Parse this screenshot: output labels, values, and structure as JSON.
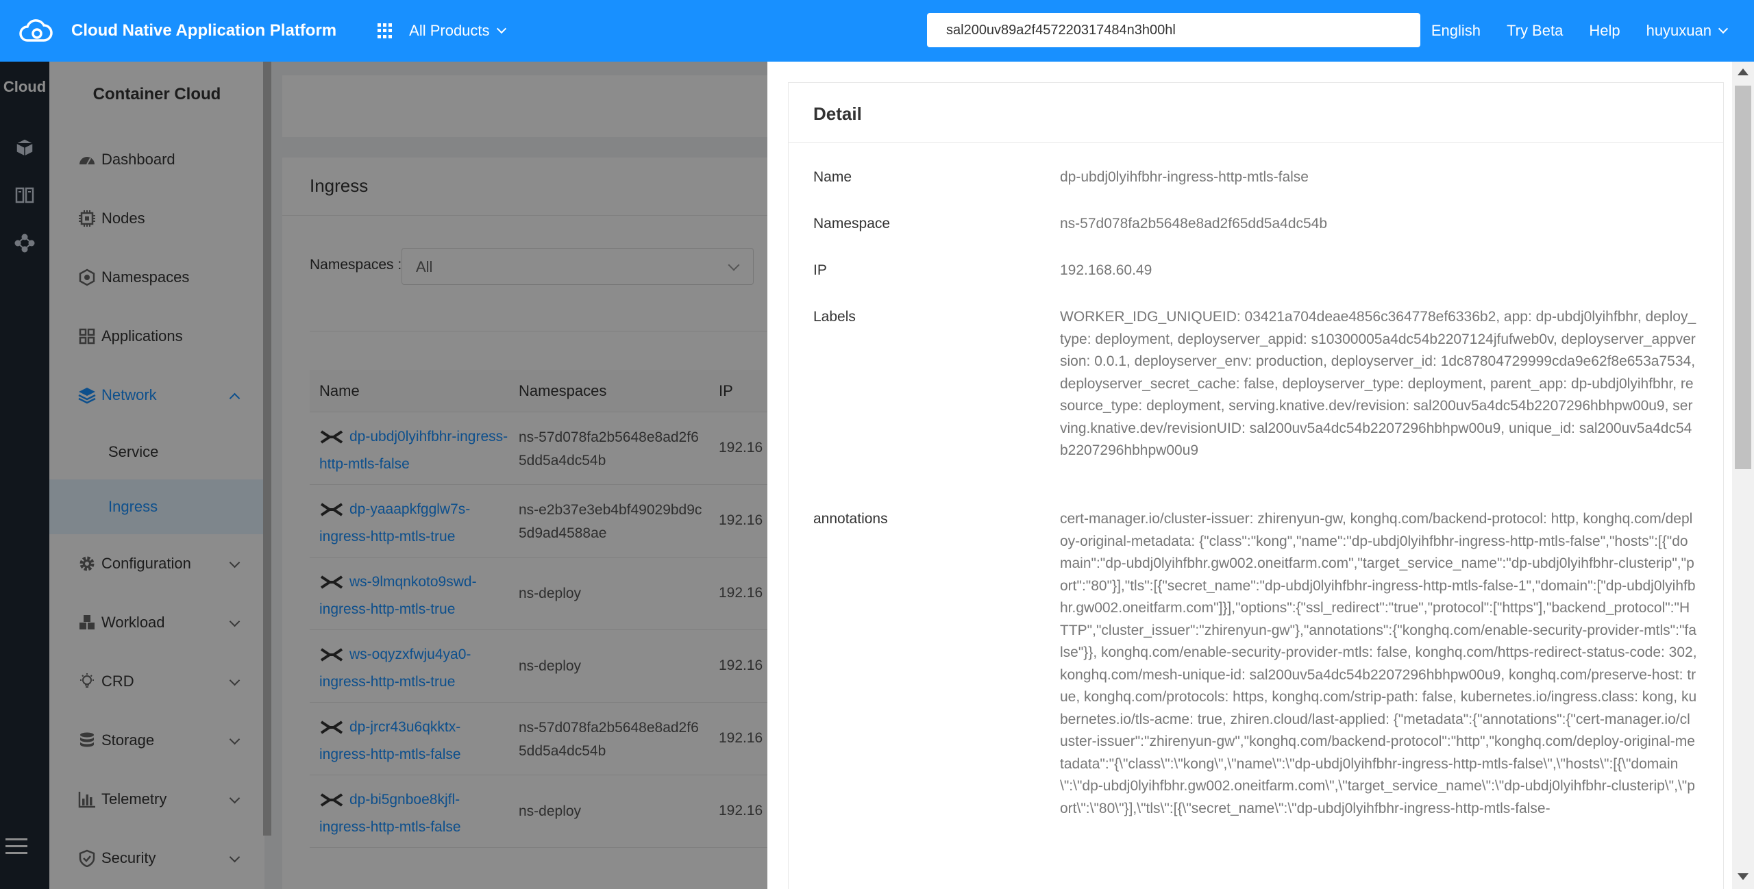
{
  "header": {
    "title": "Cloud Native Application Platform",
    "products_label": "All Products",
    "search_value": "sal200uv89a2f457220317484n3h00hl",
    "links": [
      "English",
      "Try Beta",
      "Help"
    ],
    "user": "huyuxuan",
    "brand_color": "#1890ff"
  },
  "rail": {
    "title": "Cloud"
  },
  "sidebar": {
    "title": "Container Cloud",
    "items": [
      {
        "label": "Dashboard",
        "icon": "dashboard-icon"
      },
      {
        "label": "Nodes",
        "icon": "chip-icon"
      },
      {
        "label": "Namespaces",
        "icon": "hexagon-icon"
      },
      {
        "label": "Applications",
        "icon": "apps-icon"
      },
      {
        "label": "Network",
        "icon": "layers-icon",
        "expanded": true
      },
      {
        "label": "Configuration",
        "icon": "gear-icon"
      },
      {
        "label": "Workload",
        "icon": "cubes-icon"
      },
      {
        "label": "CRD",
        "icon": "bulb-icon"
      },
      {
        "label": "Storage",
        "icon": "database-icon"
      },
      {
        "label": "Telemetry",
        "icon": "bar-chart-icon"
      },
      {
        "label": "Security",
        "icon": "shield-icon"
      }
    ],
    "network_sub": [
      "Service",
      "Ingress"
    ]
  },
  "main": {
    "title": "Ingress",
    "ns_label": "Namespaces :",
    "ns_value": "All",
    "columns": [
      "Name",
      "Namespaces",
      "IP"
    ],
    "rows": [
      {
        "name": "dp-ubdj0lyihfbhr-ingress-http-mtls-false",
        "ns": "ns-57d078fa2b5648e8ad2f65dd5a4dc54b",
        "ip": "192.16"
      },
      {
        "name": "dp-yaaapkfgglw7s-ingress-http-mtls-true",
        "ns": "ns-e2b37e3eb4bf49029bd9c5d9ad4588ae",
        "ip": "192.16"
      },
      {
        "name": "ws-9lmqnkoto9swd-ingress-http-mtls-true",
        "ns": "ns-deploy",
        "ip": "192.16"
      },
      {
        "name": "ws-oqyzxfwju4ya0-ingress-http-mtls-true",
        "ns": "ns-deploy",
        "ip": "192.16"
      },
      {
        "name": "dp-jrcr43u6qkktx-ingress-http-mtls-false",
        "ns": "ns-57d078fa2b5648e8ad2f65dd5a4dc54b",
        "ip": "192.16"
      },
      {
        "name": "dp-bi5gnboe8kjfl-ingress-http-mtls-false",
        "ns": "ns-deploy",
        "ip": "192.16"
      }
    ]
  },
  "detail": {
    "title": "Detail",
    "fields": [
      {
        "key": "Name",
        "value": "dp-ubdj0lyihfbhr-ingress-http-mtls-false"
      },
      {
        "key": "Namespace",
        "value": "ns-57d078fa2b5648e8ad2f65dd5a4dc54b"
      },
      {
        "key": "IP",
        "value": "192.168.60.49"
      },
      {
        "key": "Labels",
        "value": "WORKER_IDG_UNIQUEID: 03421a704deae4856c364778ef6336b2, app: dp-ubdj0lyihfbhr, deploy_type: deployment, deployserver_appid: s10300005a4dc54b2207124jfufweb0v, deployserver_appversion: 0.0.1, deployserver_env: production, deployserver_id: 1dc87804729999cda9e62f8e653a7534, deployserver_secret_cache: false, deployserver_type: deployment, parent_app: dp-ubdj0lyihfbhr, resource_type: deployment, serving.knative.dev/revision: sal200uv5a4dc54b2207296hbhpw00u9, serving.knative.dev/revisionUID: sal200uv5a4dc54b2207296hbhpw00u9, unique_id: sal200uv5a4dc54b2207296hbhpw00u9"
      },
      {
        "key": "annotations",
        "value": "cert-manager.io/cluster-issuer: zhirenyun-gw, konghq.com/backend-protocol: http, konghq.com/deploy-original-metadata: {\"class\":\"kong\",\"name\":\"dp-ubdj0lyihfbhr-ingress-http-mtls-false\",\"hosts\":[{\"domain\":\"dp-ubdj0lyihfbhr.gw002.oneitfarm.com\",\"target_service_name\":\"dp-ubdj0lyihfbhr-clusterip\",\"port\":\"80\"}],\"tls\":[{\"secret_name\":\"dp-ubdj0lyihfbhr-ingress-http-mtls-false-1\",\"domain\":[\"dp-ubdj0lyihfbhr.gw002.oneitfarm.com\"]}],\"options\":{\"ssl_redirect\":\"true\",\"protocol\":[\"https\"],\"backend_protocol\":\"HTTP\",\"cluster_issuer\":\"zhirenyun-gw\"},\"annotations\":{\"konghq.com/enable-security-provider-mtls\":\"false\"}}, konghq.com/enable-security-provider-mtls: false, konghq.com/https-redirect-status-code: 302, konghq.com/mesh-unique-id: sal200uv5a4dc54b2207296hbhpw00u9, konghq.com/preserve-host: true, konghq.com/protocols: https, konghq.com/strip-path: false, kubernetes.io/ingress.class: kong, kubernetes.io/tls-acme: true, zhiren.cloud/last-applied: {\"metadata\":{\"annotations\":{\"cert-manager.io/cluster-issuer\":\"zhirenyun-gw\",\"konghq.com/backend-protocol\":\"http\",\"konghq.com/deploy-original-metadata\":\"{\\\"class\\\":\\\"kong\\\",\\\"name\\\":\\\"dp-ubdj0lyihfbhr-ingress-http-mtls-false\\\",\\\"hosts\\\":[{\\\"domain\\\":\\\"dp-ubdj0lyihfbhr.gw002.oneitfarm.com\\\",\\\"target_service_name\\\":\\\"dp-ubdj0lyihfbhr-clusterip\\\",\\\"port\\\":\\\"80\\\"}],\\\"tls\\\":[{\\\"secret_name\\\":\\\"dp-ubdj0lyihfbhr-ingress-http-mtls-false-"
      }
    ]
  }
}
